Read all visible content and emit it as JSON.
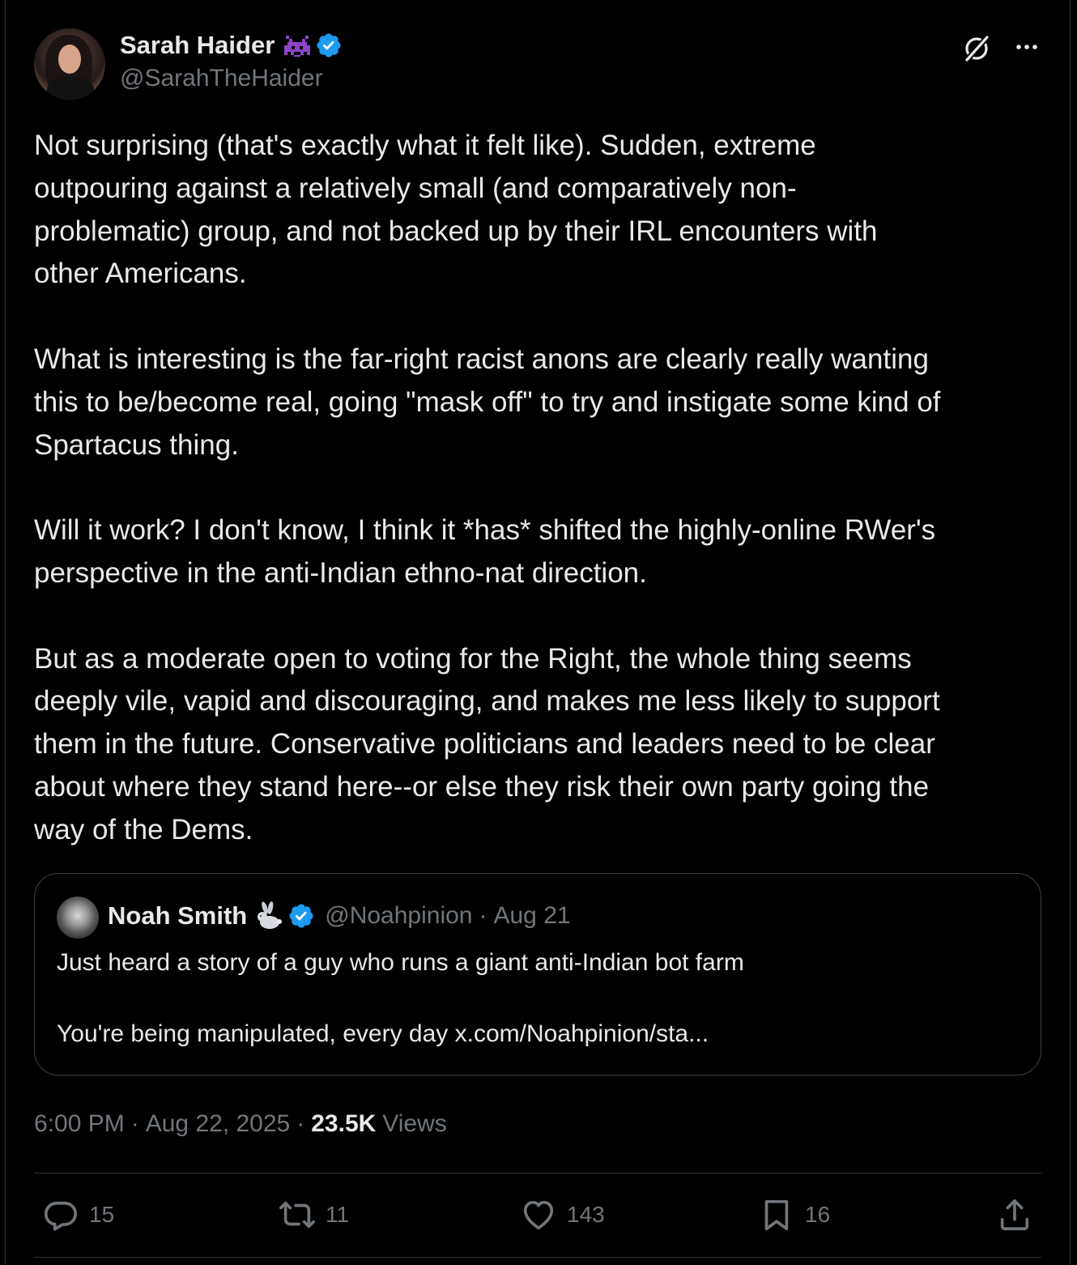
{
  "author": {
    "display_name": "Sarah Haider",
    "handle": "@SarahTheHaider",
    "verified": true
  },
  "tweet": {
    "text": "Not surprising (that's exactly what it felt like). Sudden, extreme\noutpouring against a relatively small (and comparatively non-\nproblematic) group, and not backed up by their IRL encounters with\nother Americans.\n\nWhat is interesting is the far-right racist anons are clearly really wanting\nthis to be/become real, going \"mask off\" to try and instigate some kind of\nSpartacus thing.\n\nWill it work? I don't know, I think it *has* shifted the highly-online RWer's\nperspective in the anti-Indian ethno-nat direction.\n\nBut as a moderate open to voting for the Right, the whole thing seems\ndeeply vile, vapid and discouraging, and makes me less likely to support\nthem in the future. Conservative politicians and leaders need to be clear\nabout where they stand here--or else they risk their own party going the\nway of the Dems.",
    "time": "6:00 PM",
    "date": "Aug 22, 2025",
    "views_count": "23.5K",
    "views_label": "Views"
  },
  "quote": {
    "display_name": "Noah Smith",
    "handle": "@Noahpinion",
    "separator": "·",
    "date": "Aug 21",
    "text": "Just heard a story of a guy who runs a giant anti-Indian bot farm\n\nYou're being manipulated, every day x.com/Noahpinion/sta..."
  },
  "meta_separator": "·",
  "actions": {
    "replies": "15",
    "reposts": "11",
    "likes": "143",
    "bookmarks": "16"
  },
  "icons": {
    "author_emoji": "alien-monster-icon",
    "quote_emoji": "rabbit-icon",
    "verified": "verified-badge-icon",
    "grok": "grok-icon",
    "more": "more-icon",
    "reply": "reply-icon",
    "repost": "repost-icon",
    "like": "heart-icon",
    "bookmark": "bookmark-icon",
    "share": "share-icon"
  },
  "colors": {
    "background": "#000000",
    "text_primary": "#e7e9ea",
    "text_secondary": "#71767b",
    "border": "#2f3336",
    "verified_blue": "#1d9bf0",
    "alien_purple": "#8e44c9"
  }
}
